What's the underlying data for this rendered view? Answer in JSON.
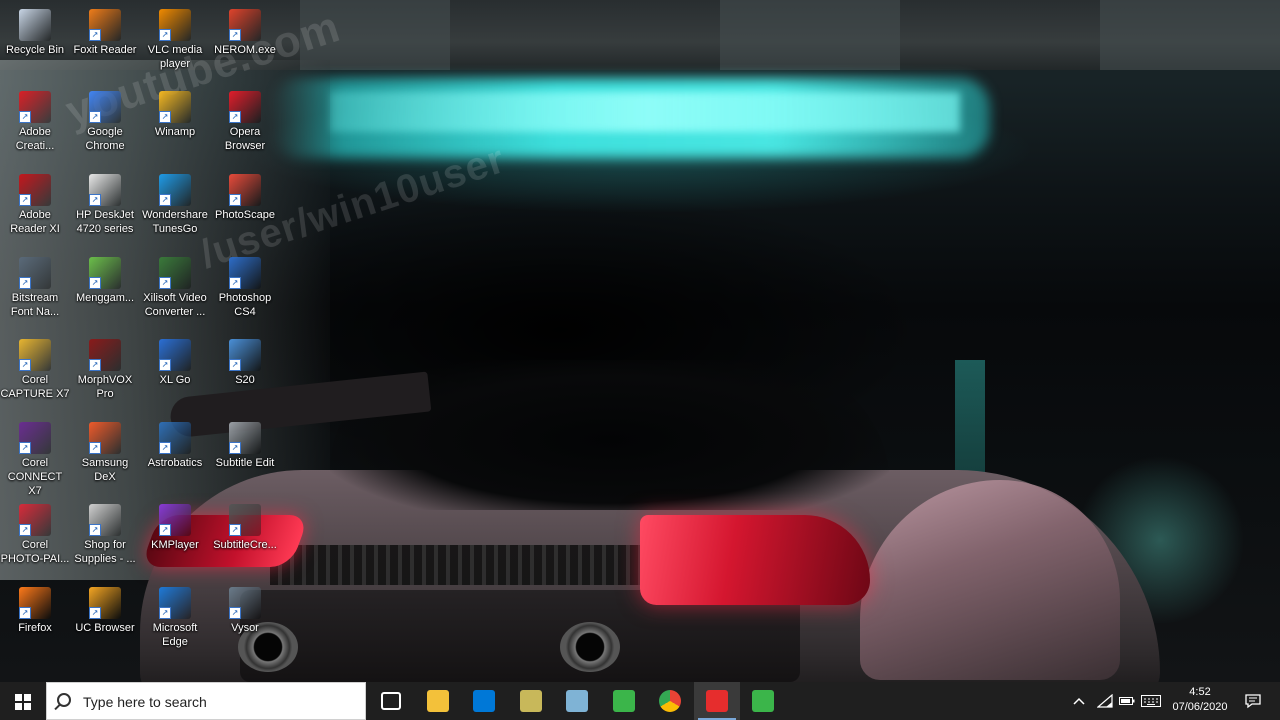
{
  "desktop_icons": [
    {
      "label": "Recycle Bin",
      "icon": "recycle-bin-icon",
      "color": "#c9d6e6"
    },
    {
      "label": "Foxit Reader",
      "icon": "foxit-reader-icon",
      "color": "#f07d1a"
    },
    {
      "label": "VLC media\nplayer",
      "icon": "vlc-icon",
      "color": "#f28b00"
    },
    {
      "label": "NEROM.exe",
      "icon": "nero-icon",
      "color": "#e0442c"
    },
    {
      "label": "Adobe\nCreati...",
      "icon": "adobe-creative-cloud-icon",
      "color": "#da1f26"
    },
    {
      "label": "Google\nChrome",
      "icon": "chrome-icon",
      "color": "#4285f4"
    },
    {
      "label": "Winamp",
      "icon": "winamp-icon",
      "color": "#f5b821"
    },
    {
      "label": "Opera\nBrowser",
      "icon": "opera-icon",
      "color": "#e11c2a"
    },
    {
      "label": "Adobe\nReader XI",
      "icon": "adobe-reader-icon",
      "color": "#c4161c"
    },
    {
      "label": "HP DeskJet\n4720 series",
      "icon": "printer-icon",
      "color": "#e8e8e8"
    },
    {
      "label": "Wondershare\nTunesGo",
      "icon": "tunesgo-icon",
      "color": "#1e9be8"
    },
    {
      "label": "PhotoScape",
      "icon": "photoscape-icon",
      "color": "#e84a3a"
    },
    {
      "label": "Bitstream\nFont Na...",
      "icon": "bitstream-icon",
      "color": "#5a6a7a"
    },
    {
      "label": "Menggam...",
      "icon": "drawing-app-icon",
      "color": "#6bbf4a"
    },
    {
      "label": "Xilisoft Video\nConverter ...",
      "icon": "xilisoft-icon",
      "color": "#3a7a3a"
    },
    {
      "label": "Photoshop\nCS4",
      "icon": "photoshop-icon",
      "color": "#2d6dc9"
    },
    {
      "label": "Corel\nCAPTURE X7",
      "icon": "corel-capture-icon",
      "color": "#e8b530"
    },
    {
      "label": "MorphVOX\nPro",
      "icon": "morphvox-icon",
      "color": "#8a1a1a"
    },
    {
      "label": "XL Go",
      "icon": "xl-go-icon",
      "color": "#2a6fd6"
    },
    {
      "label": "S20",
      "icon": "s20-icon",
      "color": "#4a90d9"
    },
    {
      "label": "Corel\nCONNECT X7",
      "icon": "corel-connect-icon",
      "color": "#6a2d91"
    },
    {
      "label": "Samsung\nDeX",
      "icon": "samsung-dex-icon",
      "color": "#ef5a2a"
    },
    {
      "label": "Astrobatics",
      "icon": "astrobatics-icon",
      "color": "#2f6fb6"
    },
    {
      "label": "Subtitle Edit",
      "icon": "subtitle-edit-icon",
      "color": "#9aa0a6"
    },
    {
      "label": "Corel\nPHOTO-PAI...",
      "icon": "corel-photopaint-icon",
      "color": "#d82a3a"
    },
    {
      "label": "Shop for\nSupplies - ...",
      "icon": "shop-supplies-icon",
      "color": "#d0d0d0"
    },
    {
      "label": "KMPlayer",
      "icon": "kmplayer-icon",
      "color": "#8a3ad6"
    },
    {
      "label": "SubtitleCre...",
      "icon": "subtitle-creator-icon",
      "color": "#555555"
    },
    {
      "label": "Firefox",
      "icon": "firefox-icon",
      "color": "#ff7a1a"
    },
    {
      "label": "UC Browser",
      "icon": "uc-browser-icon",
      "color": "#f5a623"
    },
    {
      "label": "Microsoft\nEdge",
      "icon": "edge-icon",
      "color": "#1e7ad9"
    },
    {
      "label": "Vysor",
      "icon": "vysor-icon",
      "color": "#6a7b8a"
    }
  ],
  "wallpaper": {
    "watermark_line1": "youtube.com",
    "watermark_line2": "/user/win10user",
    "neon_color": "#3ee0dd"
  },
  "taskbar": {
    "search_placeholder": "Type here to search",
    "pinned": [
      {
        "name": "task-view-icon",
        "color": "#ffffff",
        "active": false
      },
      {
        "name": "file-explorer-icon",
        "color": "#f3c13a",
        "active": false
      },
      {
        "name": "microsoft-store-icon",
        "color": "#0078d7",
        "active": false
      },
      {
        "name": "speaker-app-icon",
        "color": "#c8b85a",
        "active": false
      },
      {
        "name": "notepad-app-icon",
        "color": "#7fb3d5",
        "active": false
      },
      {
        "name": "camtasia-icon",
        "color": "#3bb54a",
        "active": false
      },
      {
        "name": "chrome-taskbar-icon",
        "color": "#4285f4",
        "active": false
      },
      {
        "name": "bandicam-icon",
        "color": "#e62d2d",
        "active": true
      },
      {
        "name": "camtasia-recorder-icon",
        "color": "#3bb54a",
        "active": false
      }
    ],
    "clock": {
      "time": "4:52",
      "date": "07/06/2020"
    }
  }
}
